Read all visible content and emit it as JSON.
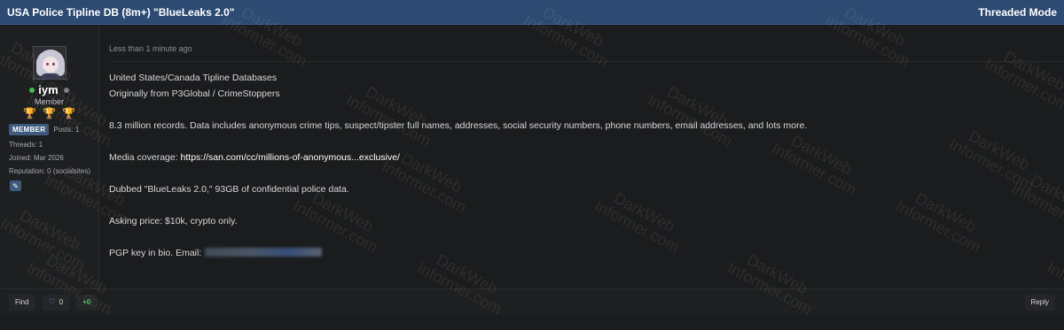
{
  "thread": {
    "title": "USA Police Tipline DB (8m+) \"BlueLeaks 2.0\"",
    "mode_label": "Threaded Mode"
  },
  "author": {
    "username": "iym",
    "rank": "Member",
    "badge": "MEMBER",
    "posts": "Posts: 1",
    "threads": "Threads: 1",
    "joined": "Joined: Mar 2026",
    "reputation": "Reputation: 0 (socialsites)",
    "trophy_glyph": "🏆",
    "edit_glyph": "✎"
  },
  "post": {
    "timestamp": "Less than 1 minute ago",
    "lines": [
      "United States/Canada Tipline Databases",
      "Originally from P3Global / CrimeStoppers",
      "8.3 million records. Data includes anonymous crime tips, suspect/tipster full names, addresses, social security numbers, phone numbers, email addresses, and lots more.",
      "Dubbed \"BlueLeaks 2.0,\" 93GB of confidential police data.",
      "Asking price: $10k, crypto only."
    ],
    "media_prefix": "Media coverage: ",
    "media_link": "https://san.com/cc/millions-of-anonymous...exclusive/",
    "pgp_text": "PGP key in bio. Email:"
  },
  "footer": {
    "find": "Find",
    "like_icon": "♡",
    "like_count": "0",
    "reputation": "+0",
    "reply": "Reply"
  },
  "watermark": {
    "line1": "DarkWeb",
    "line2": "Informer.com"
  }
}
